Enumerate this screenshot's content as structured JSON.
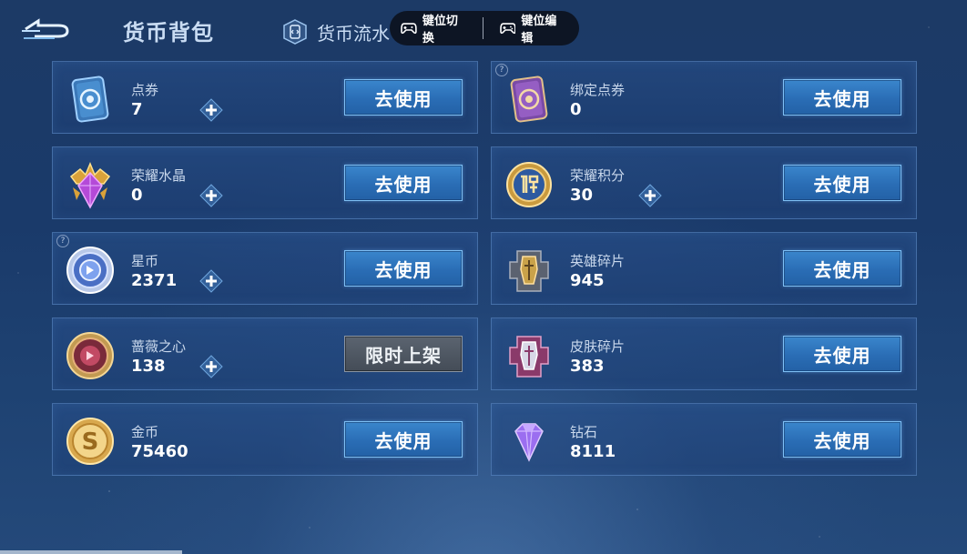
{
  "header": {
    "title": "货币背包",
    "flow_tab": "货币流水"
  },
  "overlay": {
    "switch_label": "键位切换",
    "edit_label": "键位编辑"
  },
  "items": [
    {
      "name": "点券",
      "amount": "7",
      "button": "去使用",
      "icon": "coupon-card-icon",
      "has_plus": true,
      "has_question": false
    },
    {
      "name": "绑定点券",
      "amount": "0",
      "button": "去使用",
      "icon": "bound-coupon-card-icon",
      "has_plus": false,
      "has_question": true
    },
    {
      "name": "荣耀水晶",
      "amount": "0",
      "button": "去使用",
      "icon": "glory-crystal-icon",
      "has_plus": true,
      "has_question": false
    },
    {
      "name": "荣耀积分",
      "amount": "30",
      "button": "去使用",
      "icon": "glory-points-icon",
      "has_plus": true,
      "has_question": false
    },
    {
      "name": "星币",
      "amount": "2371",
      "button": "去使用",
      "icon": "star-coin-icon",
      "has_plus": true,
      "has_question": true
    },
    {
      "name": "英雄碎片",
      "amount": "945",
      "button": "去使用",
      "icon": "hero-fragment-icon",
      "has_plus": false,
      "has_question": false
    },
    {
      "name": "蔷薇之心",
      "amount": "138",
      "button": "限时上架",
      "icon": "rose-heart-icon",
      "has_plus": true,
      "has_question": false
    },
    {
      "name": "皮肤碎片",
      "amount": "383",
      "button": "去使用",
      "icon": "skin-fragment-icon",
      "has_plus": false,
      "has_question": false
    },
    {
      "name": "金币",
      "amount": "75460",
      "button": "去使用",
      "icon": "gold-coin-icon",
      "has_plus": false,
      "has_question": false
    },
    {
      "name": "钻石",
      "amount": "8111",
      "button": "去使用",
      "icon": "diamond-icon",
      "has_plus": false,
      "has_question": false
    }
  ],
  "colors": {
    "button_blue": "#2a6db5",
    "button_gray": "#4d5560",
    "card_border": "#6ea0dc"
  }
}
